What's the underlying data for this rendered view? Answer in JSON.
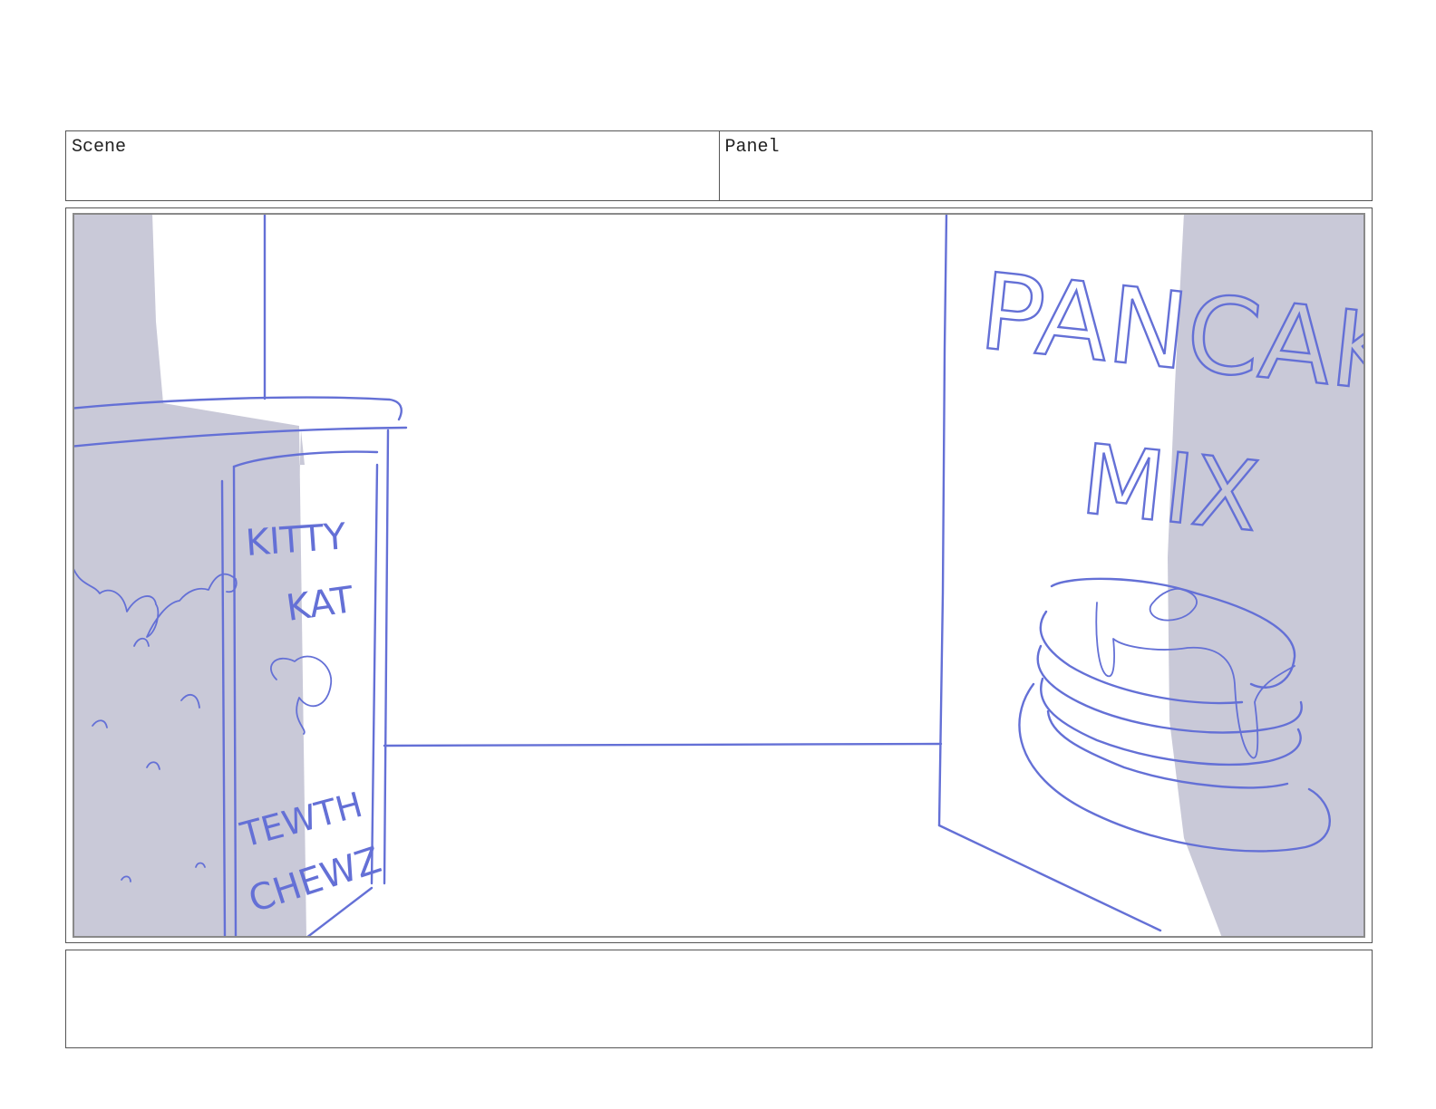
{
  "header": {
    "scene_label": "Scene",
    "panel_label": "Panel"
  },
  "frame": {
    "left_box_lines": [
      "KITTY",
      "KAT",
      "TEWTH",
      "CHEWZ"
    ],
    "right_box_lines": [
      "PANCAK",
      "MIX"
    ],
    "sketch_color": "#6470d6",
    "shade_color": "#c9c9d8"
  },
  "notes": {
    "text": ""
  }
}
